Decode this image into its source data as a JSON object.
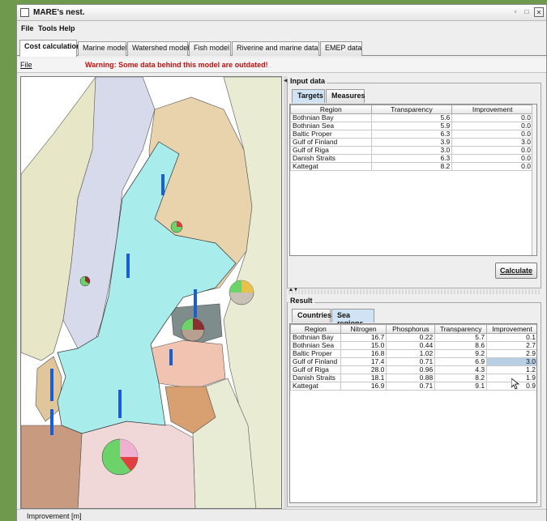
{
  "window": {
    "title": "MARE's nest."
  },
  "menu": [
    {
      "label": "File"
    },
    {
      "label": "Tools"
    },
    {
      "label": "Help"
    }
  ],
  "tabs": [
    {
      "label": "Cost calculation",
      "active": true
    },
    {
      "label": "Marine model"
    },
    {
      "label": "Watershed model"
    },
    {
      "label": "Fish model"
    },
    {
      "label": "Riverine and marine data"
    },
    {
      "label": "EMEP data"
    }
  ],
  "subbar": {
    "file_label": "File",
    "warning": "Warning: Some data behind this model are outdated!",
    "warning_color": "#c01010"
  },
  "input": {
    "title": "Input data",
    "tabs": [
      {
        "label": "Targets",
        "active": true
      },
      {
        "label": "Measures"
      }
    ],
    "columns": [
      "Region",
      "Transparency",
      "Improvement"
    ],
    "rows": [
      [
        "Bothnian Bay",
        "5.6",
        "0.0"
      ],
      [
        "Bothnian Sea",
        "5.9",
        "0.0"
      ],
      [
        "Baltic Proper",
        "6.3",
        "0.0"
      ],
      [
        "Gulf of Finland",
        "3.9",
        "3.0"
      ],
      [
        "Gulf of Riga",
        "3.0",
        "0.0"
      ],
      [
        "Danish Straits",
        "6.3",
        "0.0"
      ],
      [
        "Kattegat",
        "8.2",
        "0.0"
      ]
    ],
    "calculate_label": "Calculate"
  },
  "result": {
    "title": "Result",
    "tabs": [
      {
        "label": "Countries"
      },
      {
        "label": "Sea regions",
        "active": true
      }
    ],
    "columns": [
      "Region",
      "Nitrogen",
      "Phosphorus",
      "Transparency",
      "Improvement"
    ],
    "rows": [
      [
        "Bothnian Bay",
        "16.7",
        "0.22",
        "5.7",
        "0.1"
      ],
      [
        "Bothnian Sea",
        "15.0",
        "0.44",
        "8.6",
        "2.7"
      ],
      [
        "Baltic Proper",
        "16.8",
        "1.02",
        "9.2",
        "2.9"
      ],
      [
        "Gulf of Finland",
        "17.4",
        "0.71",
        "6.9",
        "3.0"
      ],
      [
        "Gulf of Riga",
        "28.0",
        "0.96",
        "4.3",
        "1.2"
      ],
      [
        "Danish Straits",
        "18.1",
        "0.88",
        "8.2",
        "1.9"
      ],
      [
        "Kattegat",
        "16.9",
        "0.71",
        "9.1",
        "0.9"
      ]
    ],
    "selected_row": 3
  },
  "status": {
    "text": "Improvement [m]"
  },
  "colors": {
    "sea": "#a8ecec",
    "accent_selection": "#b9cfe4",
    "bar": "#1a5fd0"
  }
}
